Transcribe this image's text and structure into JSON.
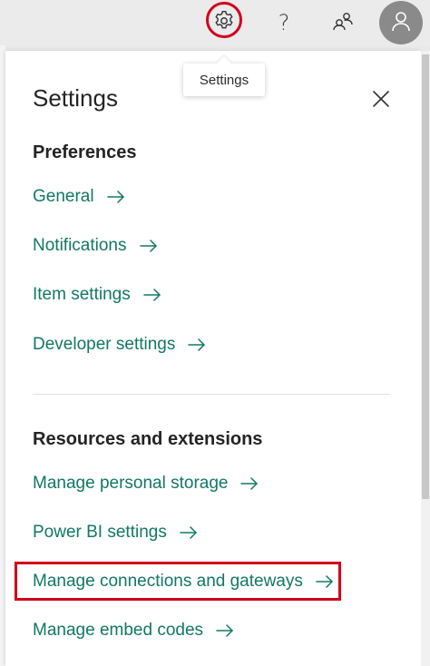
{
  "topbar": {
    "settings_icon": "gear-icon",
    "help_label": "?",
    "help_icon": "question-icon",
    "feedback_icon": "people-feedback-icon",
    "avatar_icon": "person-icon"
  },
  "tooltip": {
    "text": "Settings"
  },
  "panel": {
    "title": "Settings",
    "close_icon": "close-icon",
    "preferences": {
      "heading": "Preferences",
      "items": [
        {
          "label": "General"
        },
        {
          "label": "Notifications"
        },
        {
          "label": "Item settings"
        },
        {
          "label": "Developer settings"
        }
      ]
    },
    "resources": {
      "heading": "Resources and extensions",
      "items": [
        {
          "label": "Manage personal storage"
        },
        {
          "label": "Power BI settings"
        },
        {
          "label": "Manage connections and gateways"
        },
        {
          "label": "Manage embed codes"
        }
      ]
    }
  },
  "colors": {
    "link": "#117865",
    "highlight": "#d0021b",
    "heading": "#242424",
    "topbar": "#ebebeb"
  }
}
